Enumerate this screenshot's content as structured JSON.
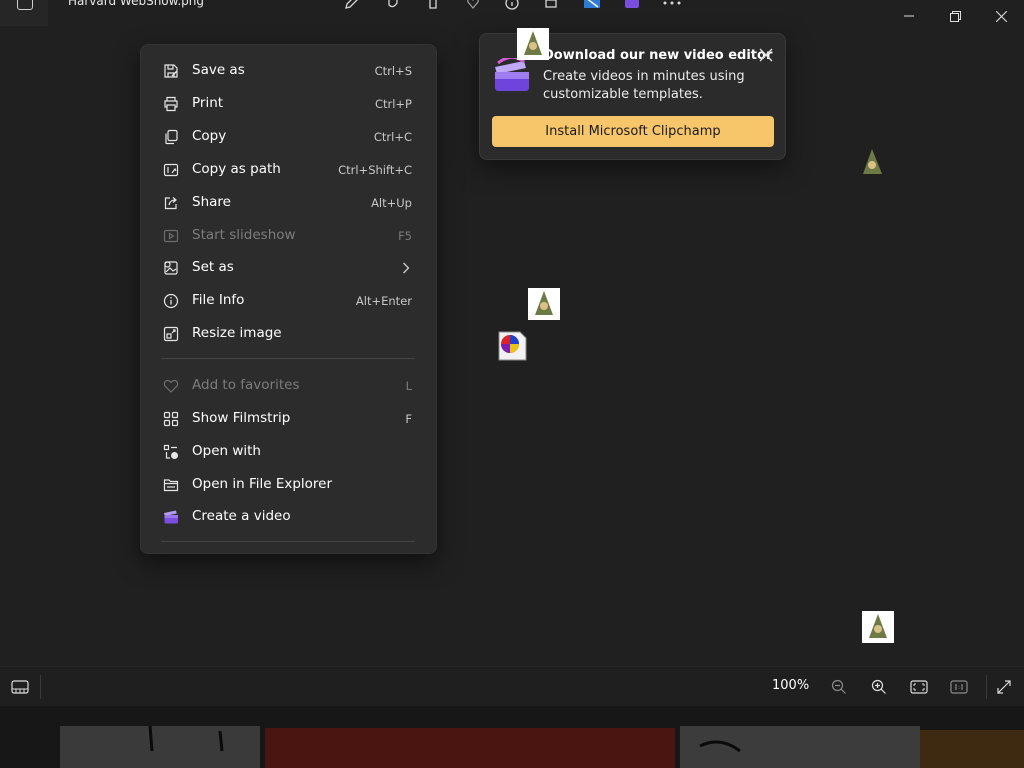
{
  "window": {
    "file_title": "Harvard WebShow.png"
  },
  "menu": {
    "items": [
      {
        "label": "Save as",
        "shortcut": "Ctrl+S",
        "icon": "save-as-icon",
        "disabled": false
      },
      {
        "label": "Print",
        "shortcut": "Ctrl+P",
        "icon": "print-icon",
        "disabled": false
      },
      {
        "label": "Copy",
        "shortcut": "Ctrl+C",
        "icon": "copy-icon",
        "disabled": false
      },
      {
        "label": "Copy as path",
        "shortcut": "Ctrl+Shift+C",
        "icon": "copy-path-icon",
        "disabled": false
      },
      {
        "label": "Share",
        "shortcut": "Alt+Up",
        "icon": "share-icon",
        "disabled": false
      },
      {
        "label": "Start slideshow",
        "shortcut": "F5",
        "icon": "slideshow-icon",
        "disabled": true
      },
      {
        "label": "Set as",
        "shortcut": "",
        "icon": "set-as-icon",
        "disabled": false,
        "submenu": true
      },
      {
        "label": "File Info",
        "shortcut": "Alt+Enter",
        "icon": "info-icon",
        "disabled": false
      },
      {
        "label": "Resize image",
        "shortcut": "",
        "icon": "resize-icon",
        "disabled": false
      },
      {
        "label": "Add to favorites",
        "shortcut": "L",
        "icon": "heart-icon",
        "disabled": true
      },
      {
        "label": "Show Filmstrip",
        "shortcut": "F",
        "icon": "filmstrip-icon",
        "disabled": false
      },
      {
        "label": "Open with",
        "shortcut": "",
        "icon": "open-with-icon",
        "disabled": false
      },
      {
        "label": "Open in File Explorer",
        "shortcut": "",
        "icon": "folder-icon",
        "disabled": false
      },
      {
        "label": "Create a video",
        "shortcut": "",
        "icon": "clipchamp-icon",
        "disabled": false
      }
    ]
  },
  "popup": {
    "title": "Download our new video editor",
    "body": "Create videos in minutes using customizable templates.",
    "button": "Install Microsoft Clipchamp"
  },
  "bottombar": {
    "zoom": "100%"
  },
  "colors": {
    "background": "#202020",
    "menu": "#2c2c2c",
    "accent_button": "#f7c66b"
  }
}
